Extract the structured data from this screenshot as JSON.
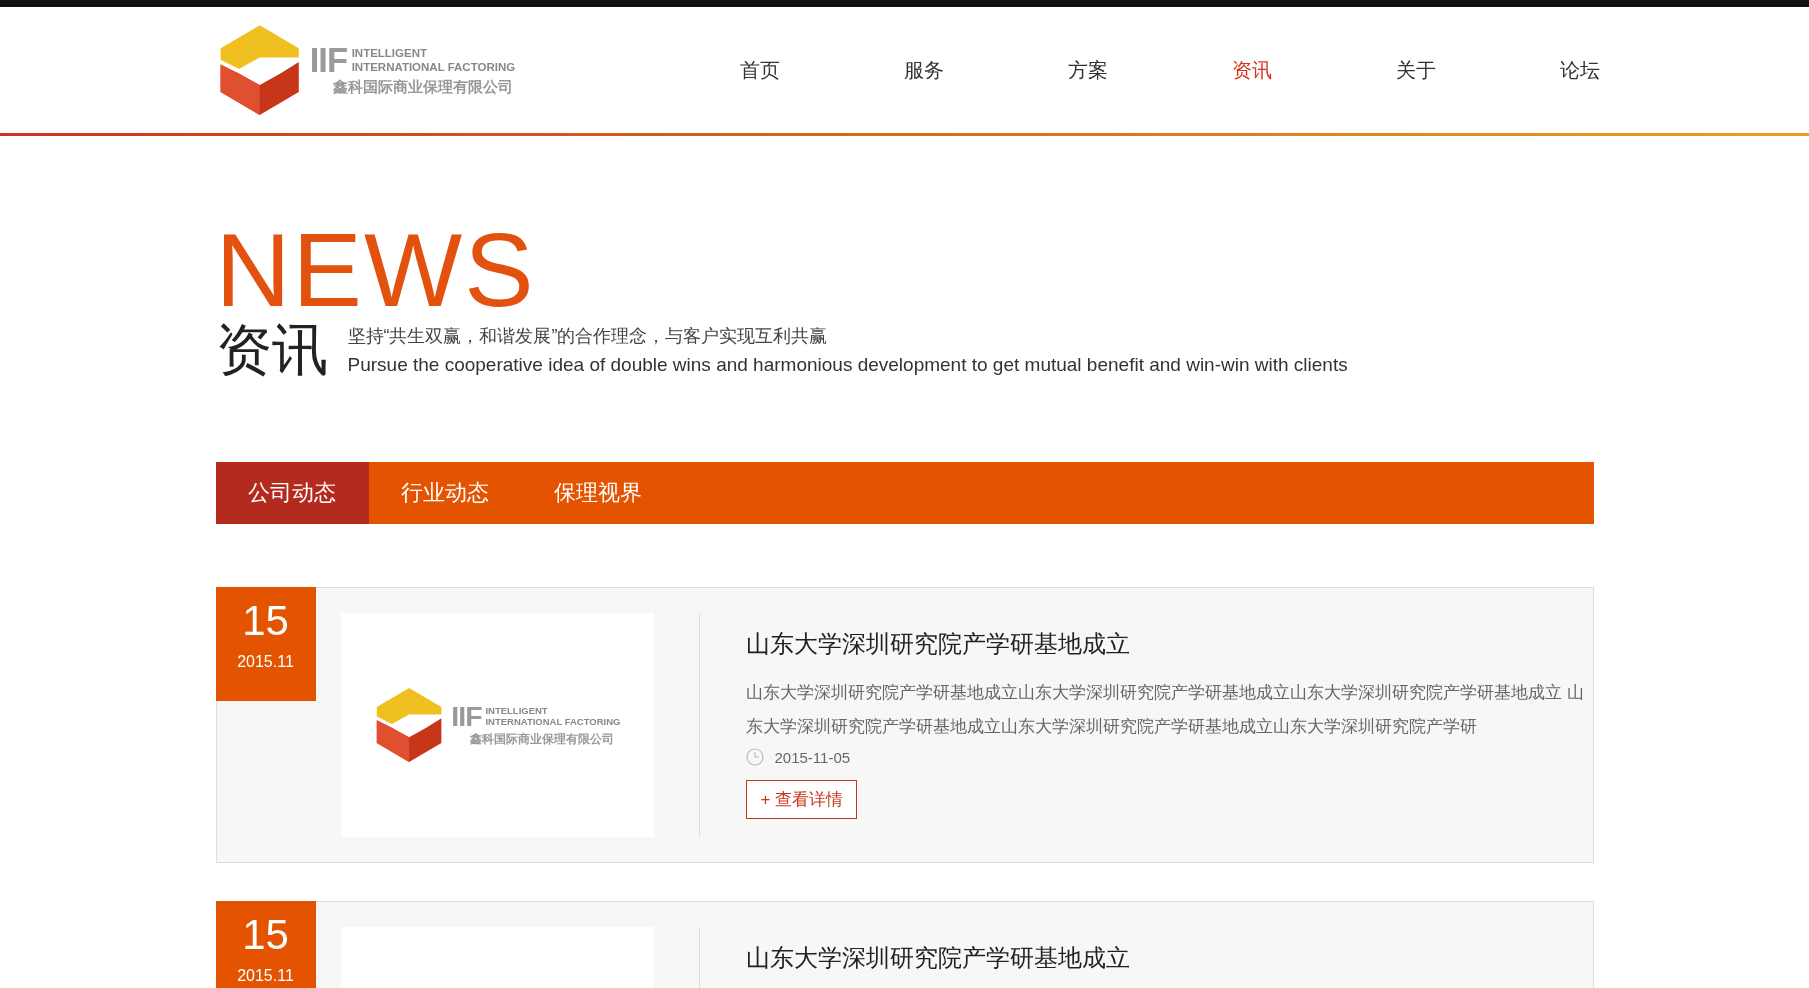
{
  "header": {
    "logo": {
      "mark": "IIF",
      "line_1": "INTELLIGENT",
      "line_2": "INTERNATIONAL FACTORING",
      "company": "鑫科国际商业保理有限公司"
    },
    "nav": [
      {
        "label": "首页",
        "selected": false
      },
      {
        "label": "服务",
        "selected": false
      },
      {
        "label": "方案",
        "selected": false
      },
      {
        "label": "资讯",
        "selected": true
      },
      {
        "label": "关于",
        "selected": false
      },
      {
        "label": "论坛",
        "selected": false
      }
    ]
  },
  "hero": {
    "title_en": "NEWS",
    "title_zh": "资讯",
    "slogan_zh": "坚持“共生双赢，和谐发展”的合作理念，与客户实现互利共赢",
    "slogan_en": "Pursue the cooperative idea of double wins and harmonious development to get mutual benefit and win-win with clients"
  },
  "tabs": [
    {
      "label": "公司动态",
      "selected": true
    },
    {
      "label": "行业动态",
      "selected": false
    },
    {
      "label": "保理视界",
      "selected": false
    }
  ],
  "news": [
    {
      "day": "15",
      "month": "2015.11",
      "thumbnail": {
        "mark": "IIF",
        "line_1": "INTELLIGENT",
        "line_2": "INTERNATIONAL FACTORING",
        "company": "鑫科国际商业保理有限公司"
      },
      "title": "山东大学深圳研究院产学研基地成立",
      "summary": "山东大学深圳研究院产学研基地成立山东大学深圳研究院产学研基地成立山东大学深圳研究院产学研基地成立 山东大学深圳研究院产学研基地成立山东大学深圳研究院产学研基地成立山东大学深圳研究院产学研",
      "date": "2015-11-05",
      "button": "+ 查看详情"
    },
    {
      "day": "15",
      "month": "2015.11",
      "title": "山东大学深圳研究院产学研基地成立"
    }
  ]
}
